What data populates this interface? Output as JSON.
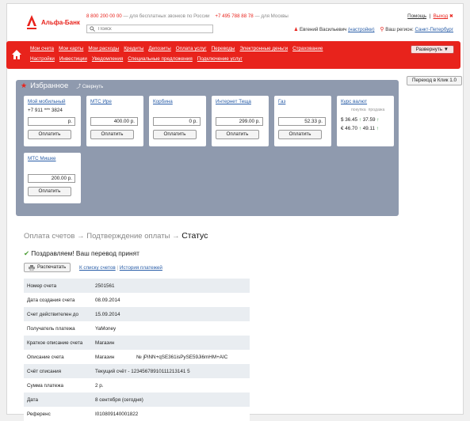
{
  "header": {
    "logo_text": "Альфа-Банк",
    "phone1": "8 800 200 00 00",
    "phone1_note": "— для бесплатных звонков по России",
    "phone2": "+7 495 788 88 78",
    "phone2_note": "— для Москвы",
    "search_placeholder": "Поиск",
    "help_link": "Помощь",
    "exit_link": "Выход",
    "user_name": "Евгений Васильевич",
    "settings_link": "(настройки)",
    "region_label": "Ваш регион:",
    "region_value": "Санкт-Петербург"
  },
  "nav": {
    "row1": [
      "Мои счета",
      "Мои карты",
      "Мои расходы",
      "Кредиты",
      "Депозиты",
      "Оплата услуг",
      "Переводы",
      "Электронные деньги",
      "Страхование"
    ],
    "row2": [
      "Настройки",
      "Инвестиции",
      "Уведомления",
      "Специальные предложения",
      "Подключение услуг"
    ],
    "expand_button": "Развернуть ▼"
  },
  "klik_button": "Переход в Клик 1.0",
  "favorites": {
    "title": "Избранное",
    "toggle": "Свернуть",
    "currency_symbol": "р.",
    "pay_label": "Оплатить",
    "cards": [
      {
        "name": "Мой мобильный",
        "sub": "+7 911 *** 3824",
        "amount": "р."
      },
      {
        "name": "МТС Ире",
        "sub": "",
        "amount": "400.00  р."
      },
      {
        "name": "Корбина",
        "sub": "",
        "amount": "0  р."
      },
      {
        "name": "Интернет Теща",
        "sub": "",
        "amount": "299.00  р."
      },
      {
        "name": "Газ",
        "sub": "",
        "amount": "52.33  р."
      },
      {
        "name": "МТС Мишке",
        "sub": "",
        "amount": "200.00  р."
      }
    ],
    "rates": {
      "title": "Курс валют",
      "buy_label": "покупка",
      "sell_label": "продажа",
      "rows": [
        {
          "currency": "$",
          "buy": "36.45",
          "sell": "37.59"
        },
        {
          "currency": "€",
          "buy": "46.70",
          "sell": "49.11"
        }
      ]
    }
  },
  "breadcrumb": {
    "step1": "Оплата счетов",
    "step2": "Подтверждение оплаты",
    "current": "Статус",
    "arrow": "→"
  },
  "status": {
    "tick": "✔",
    "message": "Поздравляем! Ваш перевод принят",
    "print_button": "Распечатать",
    "link_accounts": "К списку счетов",
    "link_history": "История платежей"
  },
  "details": [
    {
      "label": "Номер счета",
      "value": "2501561"
    },
    {
      "label": "Дата создания счета",
      "value": "08.09.2014"
    },
    {
      "label": "Счет действителен до",
      "value": "15.09.2014"
    },
    {
      "label": "Получатель платежа",
      "value": "YaMoney"
    },
    {
      "label": "Краткое описание счета",
      "value": "Магазин"
    },
    {
      "label": "Описание счета",
      "value": "Магазин",
      "extra": "№ jPiNN+qSE361isPySE59Ji6mHM+AIC"
    },
    {
      "label": "Счёт списания",
      "value": "Текущий счёт - 12345678910111213141 5"
    },
    {
      "label": "Сумма платежа",
      "value": "2 р."
    },
    {
      "label": "Дата",
      "value": "8 сентября (сегодня)"
    },
    {
      "label": "Референс",
      "value": "I010809140001822"
    }
  ]
}
